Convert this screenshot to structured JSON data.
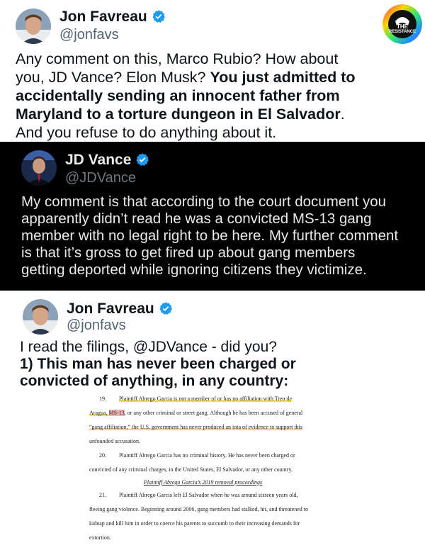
{
  "tweet1": {
    "name": "Jon Favreau",
    "handle": "@jonfavs",
    "lines": [
      [
        "Any comment on this, Marco Rubio? How about"
      ],
      [
        "you, JD Vance? Elon Musk? ",
        "You just admitted to"
      ],
      [
        "accidentally sending an innocent father from"
      ],
      [
        "Maryland to a torture dungeon in El Salvador",
        "."
      ],
      [
        "And you refuse to do anything about it."
      ]
    ],
    "logo_text_top": "THE",
    "logo_text_bottom": "RESISTANCE"
  },
  "tweet2": {
    "name": "JD Vance",
    "handle": "@JDVance",
    "lines": [
      "My comment is that according to the court document you",
      "apparently didn’t read he was a convicted MS-13 gang",
      "member with no legal right to be here. My further comment",
      "is that it’s gross to get fired up about gang members",
      "getting deported while ignoring citizens they victimize."
    ]
  },
  "tweet3": {
    "name": "Jon Favreau",
    "handle": "@jonfavs",
    "line1": "I read the filings, @JDVance - did you?",
    "line2": "1) This man has never been charged or",
    "line3": "convicted of anything, in any country:"
  },
  "document": {
    "p19_num": "19.",
    "p19_l1": "Plaintiff Abrego Garcia is not a member of or has no affiliation with Tren de",
    "p19_l2a": "Aragua, ",
    "p19_l2b": "MS-13",
    "p19_l2c": ", or any other criminal or street gang. Although he has been accused of general",
    "p19_l3": "“gang affiliation,” the U.S. government has never produced an iota of evidence to support this",
    "p19_l4": "unfounded accusation.",
    "p20_num": "20.",
    "p20_l1": "Plaintiff Abrego Garcia has no criminal history. He has never been charged or",
    "p20_l2": "convicted of any criminal charges, in the United States, El Salvador, or any other country.",
    "section": "Plaintiff Abrego Garcia’s 2019 removal proceedings",
    "p21_num": "21.",
    "p21_l1": "Plaintiff Abrego Garcia left El Salvador when he was around sixteen years old,",
    "p21_l2": "fleeing gang violence. Beginning around 2006, gang members had stalked, hit, and threatened to",
    "p21_l3": "kidnap and kill him in order to coerce his parents to succumb to their increasing demands for",
    "p21_l4": "extortion."
  },
  "colors": {
    "verified": "#1d9bf0",
    "highlight": "#f2e23a"
  }
}
